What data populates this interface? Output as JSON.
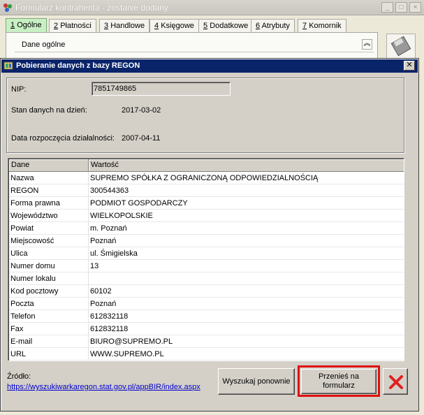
{
  "parent_window": {
    "title": "Formularz kontrahenta - zostanie dodany",
    "tabs": [
      {
        "key": "1",
        "label": "Ogólne",
        "active": true
      },
      {
        "key": "2",
        "label": "Płatności"
      },
      {
        "key": "3",
        "label": "Handlowe"
      },
      {
        "key": "4",
        "label": "Księgowe"
      },
      {
        "key": "5",
        "label": "Dodatkowe"
      },
      {
        "key": "6",
        "label": "Atrybuty"
      },
      {
        "key": "7",
        "label": "Komornik"
      }
    ],
    "section_label": "Dane ogólne",
    "accent_tab_color": "#c9f0c4"
  },
  "dialog": {
    "title": "Pobieranie danych z bazy REGON",
    "titlebar_color": "#0a246a",
    "nip_label": "NIP:",
    "nip_value": "7851749865",
    "state_label": "Stan danych na dzień:",
    "state_value": "2017-03-02",
    "start_label": "Data rozpoczęcia działalności:",
    "start_value": "2007-04-11",
    "grid": {
      "columns": [
        "Dane",
        "Wartość"
      ],
      "rows": [
        [
          "Nazwa",
          "SUPREMO SPÓŁKA Z OGRANICZONĄ ODPOWIEDZIALNOŚCIĄ"
        ],
        [
          "REGON",
          "300544363"
        ],
        [
          "Forma prawna",
          "PODMIOT GOSPODARCZY"
        ],
        [
          "Województwo",
          "WIELKOPOLSKIE"
        ],
        [
          "Powiat",
          "m. Poznań"
        ],
        [
          "Miejscowość",
          "Poznań"
        ],
        [
          "Ulica",
          "ul. Śmigielska"
        ],
        [
          "Numer domu",
          "13"
        ],
        [
          "Numer lokalu",
          ""
        ],
        [
          "Kod pocztowy",
          "60102"
        ],
        [
          "Poczta",
          "Poznań"
        ],
        [
          "Telefon",
          "612832118"
        ],
        [
          "Fax",
          "612832118"
        ],
        [
          "E-mail",
          "BIURO@SUPREMO.PL"
        ],
        [
          "URL",
          "WWW.SUPREMO.PL"
        ]
      ]
    },
    "source_label": "Źródło:",
    "source_link": "https://wyszukiwarkaregon.stat.gov.pl/appBIR/index.aspx",
    "buttons": {
      "research": "Wyszukaj ponownie",
      "transfer_line1": "Przenieś na",
      "transfer_line2": "formularz",
      "highlight_color": "#e01010"
    }
  }
}
